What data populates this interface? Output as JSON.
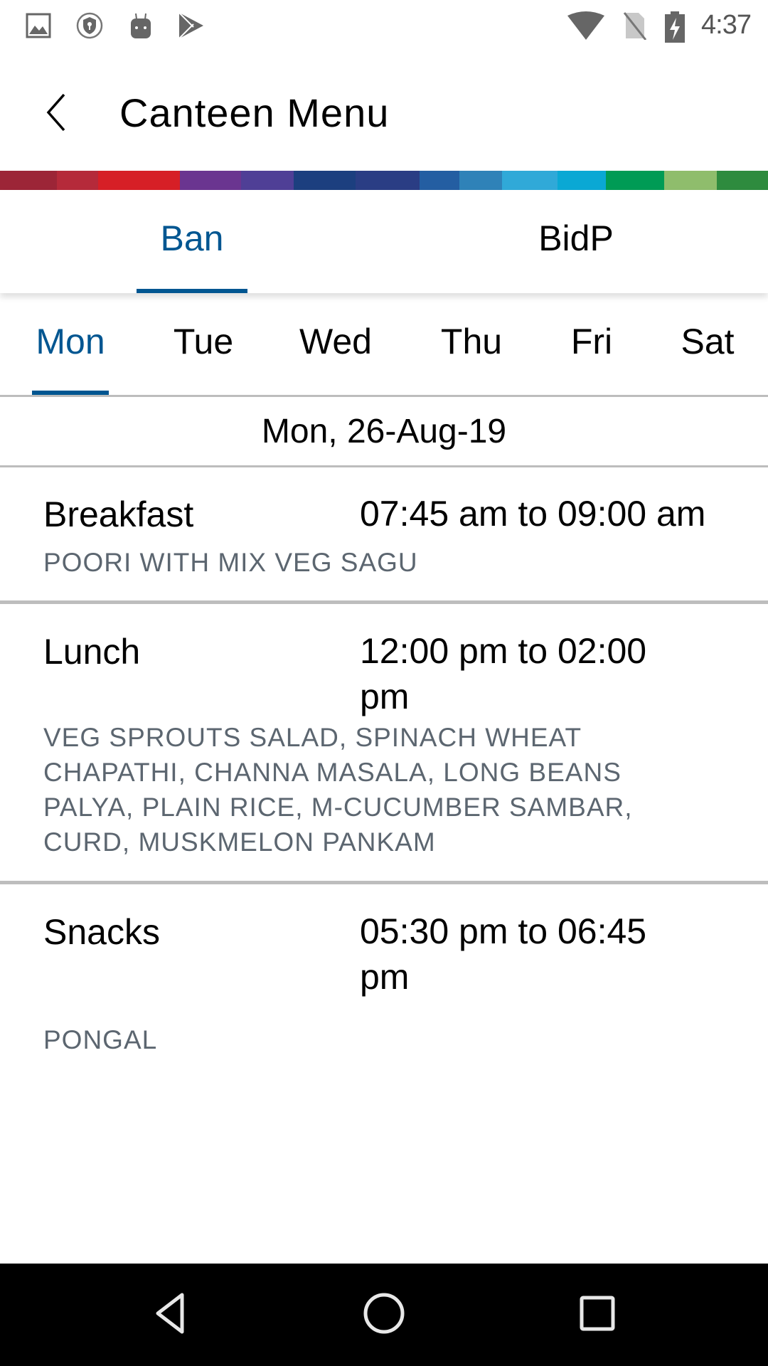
{
  "status_bar": {
    "time": "4:37",
    "left_icons": [
      "gallery-icon",
      "vpn-shield-icon",
      "android-bot-icon",
      "play-store-icon"
    ],
    "right_icons": [
      "wifi-icon",
      "no-sim-icon",
      "battery-charging-icon"
    ]
  },
  "app_bar": {
    "title": "Canteen Menu",
    "back_icon": "chevron-left-icon"
  },
  "brand_stripe": {
    "colors": [
      "#9c2537",
      "#b52a3a",
      "#d61f26",
      "#6a3590",
      "#4f3f96",
      "#1c3f7f",
      "#2a3d84",
      "#245ea2",
      "#2f82b8",
      "#30a9d8",
      "#0aa8d4",
      "#009b55",
      "#8fbd6c",
      "#2e8b3e"
    ]
  },
  "location_tabs": [
    {
      "label": "Ban",
      "active": true
    },
    {
      "label": "BidP",
      "active": false
    }
  ],
  "day_tabs": [
    {
      "label": "Mon",
      "active": true
    },
    {
      "label": "Tue",
      "active": false
    },
    {
      "label": "Wed",
      "active": false
    },
    {
      "label": "Thu",
      "active": false
    },
    {
      "label": "Fri",
      "active": false
    },
    {
      "label": "Sat",
      "active": false
    }
  ],
  "selected_date": "Mon, 26-Aug-19",
  "meals": [
    {
      "name": "Breakfast",
      "time": "07:45 am to 09:00 am",
      "items": "POORI WITH MIX VEG SAGU"
    },
    {
      "name": "Lunch",
      "time": "12:00 pm to 02:00 pm",
      "items": "VEG SPROUTS SALAD, SPINACH WHEAT CHAPATHI, CHANNA MASALA, LONG BEANS PALYA, PLAIN RICE, M-CUCUMBER SAMBAR, CURD, MUSKMELON PANKAM"
    },
    {
      "name": "Snacks",
      "time": "05:30 pm to 06:45 pm",
      "items": "PONGAL"
    }
  ],
  "nav_bar": {
    "buttons": [
      "back-triangle-icon",
      "home-circle-icon",
      "recents-square-icon"
    ]
  },
  "colors": {
    "accent": "#005691",
    "divider": "#bdbdbd",
    "menu_item_text": "#5c6670"
  }
}
